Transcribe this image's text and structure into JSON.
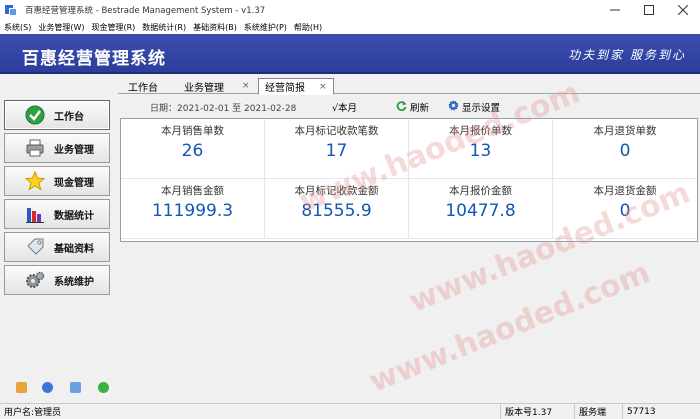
{
  "window": {
    "title": "百惠经营管理系统 - Bestrade Management System - v1.37"
  },
  "menu": [
    "系统(S)",
    "业务管理(W)",
    "现金管理(R)",
    "数据统计(R)",
    "基础资料(B)",
    "系统维护(P)",
    "帮助(H)"
  ],
  "banner": {
    "title": "百惠经营管理系统",
    "slogan": "功夫到家 服务到心"
  },
  "sidebar": {
    "items": [
      {
        "label": "工作台",
        "icon": "check-circle-icon",
        "active": true
      },
      {
        "label": "业务管理",
        "icon": "printer-icon"
      },
      {
        "label": "现金管理",
        "icon": "star-icon"
      },
      {
        "label": "数据统计",
        "icon": "bar-chart-icon"
      },
      {
        "label": "基础资料",
        "icon": "tag-icon"
      },
      {
        "label": "系统维护",
        "icon": "gear-icon"
      }
    ]
  },
  "tabs": [
    {
      "label": "工作台",
      "closable": false
    },
    {
      "label": "业务管理",
      "closable": true
    },
    {
      "label": "经营简报",
      "closable": true,
      "active": true
    }
  ],
  "toolbar": {
    "date_label": "日期：2021-02-01 至 2021-02-28",
    "month_label": "√本月",
    "refresh_label": "刷新",
    "display_settings_label": "显示设置"
  },
  "stats": [
    {
      "label": "本月销售单数",
      "value": "26"
    },
    {
      "label": "本月标记收款笔数",
      "value": "17"
    },
    {
      "label": "本月报价单数",
      "value": "13"
    },
    {
      "label": "本月退货单数",
      "value": "0"
    },
    {
      "label": "本月销售金额",
      "value": "111999.3"
    },
    {
      "label": "本月标记收款金额",
      "value": "81555.9"
    },
    {
      "label": "本月报价金额",
      "value": "10477.8"
    },
    {
      "label": "本月退货金额",
      "value": "0"
    }
  ],
  "watermark": "www.haoded.com",
  "statusbar": {
    "user": "用户名:管理员",
    "version": "版本号1.37",
    "server_label": "服务端",
    "server_value": "57713"
  },
  "colors": {
    "banner": "#3c4fb0",
    "value_text": "#1456b4"
  }
}
